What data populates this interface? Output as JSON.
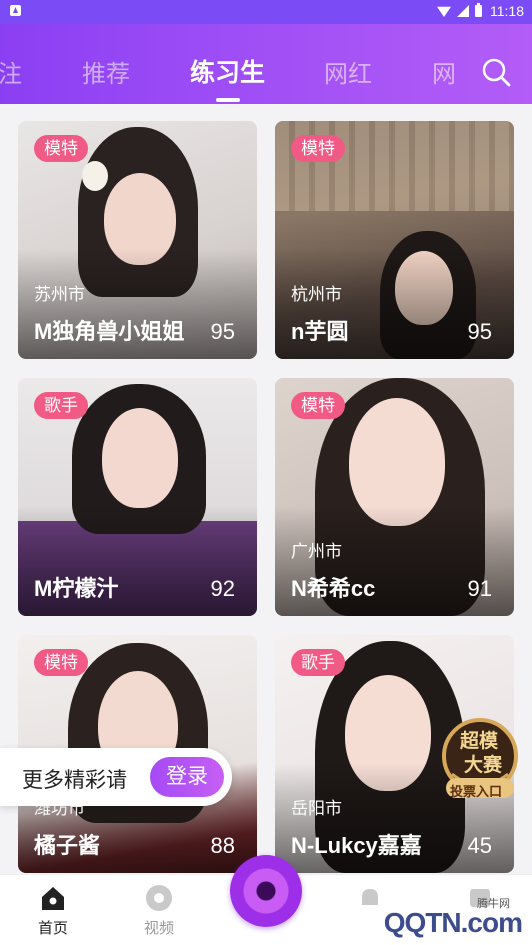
{
  "status_bar": {
    "time": "11:18"
  },
  "tabs": [
    {
      "label": "注"
    },
    {
      "label": "推荐"
    },
    {
      "label": "练习生"
    },
    {
      "label": "网红"
    },
    {
      "label": "网"
    }
  ],
  "active_tab": "练习生",
  "cards": [
    {
      "tag": "模特",
      "city": "苏州市",
      "name": "M独角兽小姐姐",
      "score": "95"
    },
    {
      "tag": "模特",
      "city": "杭州市",
      "name": "n芋圆",
      "score": "95"
    },
    {
      "tag": "歌手",
      "city": "",
      "name": "M柠檬汁",
      "score": "92"
    },
    {
      "tag": "模特",
      "city": "广州市",
      "name": "N希希cc",
      "score": "91"
    },
    {
      "tag": "模特",
      "city": "潍坊市",
      "name": "橘子酱",
      "score": "88"
    },
    {
      "tag": "歌手",
      "city": "岳阳市",
      "name": "N-Lukcy嘉嘉",
      "score": "45"
    }
  ],
  "login_banner": {
    "message": "更多精彩请",
    "button": "登录"
  },
  "contest_badge": {
    "title_line1": "超模",
    "title_line2": "大赛",
    "entry": "投票入口"
  },
  "bottom_nav": [
    {
      "label": "首页"
    },
    {
      "label": "视频"
    },
    {
      "label": ""
    },
    {
      "label": ""
    },
    {
      "label": ""
    }
  ],
  "watermark": {
    "text": "QQTN.com",
    "small": "腾牛网"
  },
  "colors": {
    "accent": "#9d4df6",
    "tag_pink": "#f25a86"
  }
}
